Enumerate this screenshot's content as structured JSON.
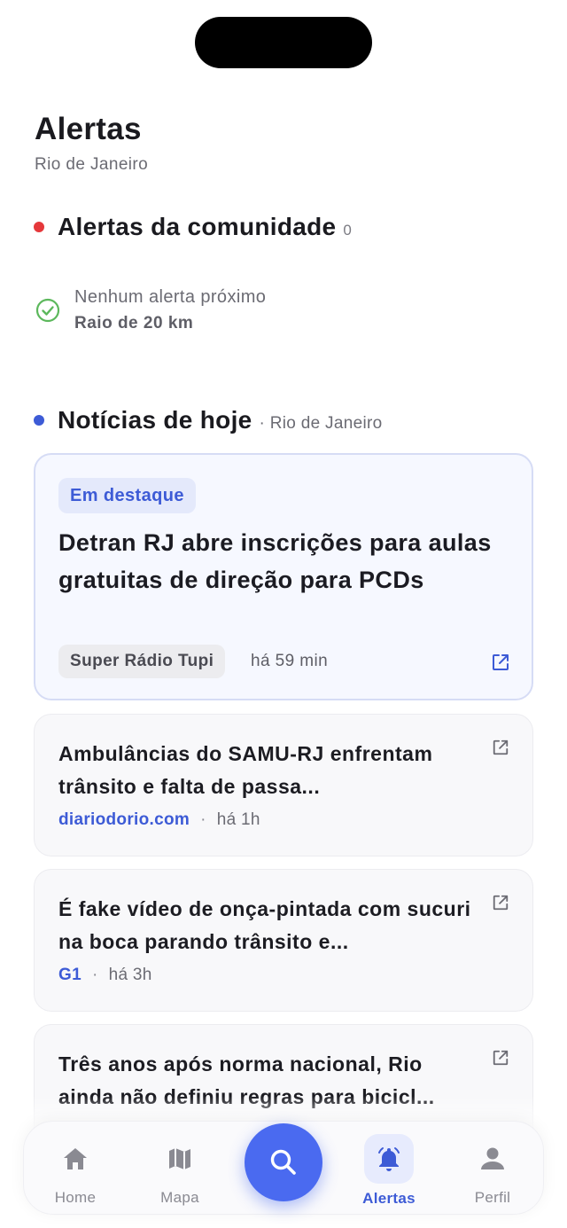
{
  "header": {
    "title": "Alertas",
    "location": "Rio de Janeiro"
  },
  "community": {
    "title": "Alertas da comunidade",
    "count": "0",
    "dot_color": "#e5383b",
    "empty_title": "Nenhum alerta próximo",
    "empty_radius": "Raio de 20 km",
    "icon": "check-circle-icon"
  },
  "news": {
    "title": "Notícias de hoje",
    "meta": "· Rio de Janeiro",
    "dot_color": "#3d5bd6",
    "featured": {
      "badge": "Em destaque",
      "title": "Detran RJ abre inscrições para aulas gratuitas de direção para PCDs",
      "source": "Super Rádio Tupi",
      "time": "há 59 min",
      "icon": "external-link-icon"
    },
    "items": [
      {
        "title": "Ambulâncias do SAMU-RJ enfrentam trânsito e falta de passa...",
        "source": "diariodorio.com",
        "sep": "·",
        "time": "há 1h"
      },
      {
        "title": "É fake vídeo de onça-pintada com sucuri na boca parando trânsito e...",
        "source": "G1",
        "sep": "·",
        "time": "há 3h"
      },
      {
        "title": "Três anos após norma nacional, Rio ainda não definiu regras para bicicl...",
        "source": "",
        "sep": "",
        "time": ""
      }
    ]
  },
  "tabbar": {
    "items": [
      {
        "label": "Home",
        "icon": "home-icon"
      },
      {
        "label": "Mapa",
        "icon": "map-icon"
      },
      {
        "label": "",
        "icon": "search-icon"
      },
      {
        "label": "Alertas",
        "icon": "bell-icon",
        "active": true
      },
      {
        "label": "Perfil",
        "icon": "person-icon"
      }
    ],
    "accent": "#4a6af0",
    "inactive_color": "#8a8a92"
  }
}
